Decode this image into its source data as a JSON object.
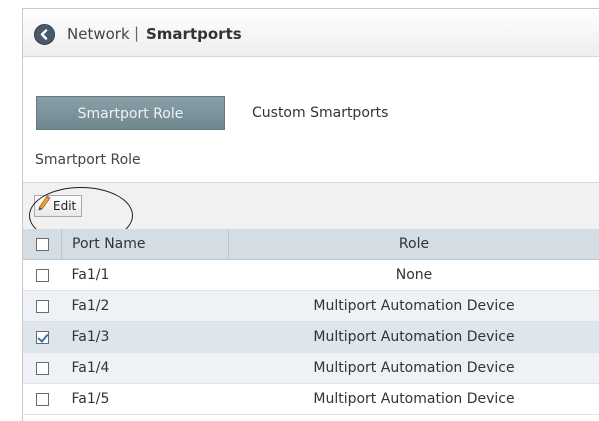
{
  "header": {
    "back_icon": "back-arrow-icon",
    "parent": "Network",
    "separator": "|",
    "current": "Smartports"
  },
  "tabs": [
    {
      "label": "Smartport Role",
      "active": true
    },
    {
      "label": "Custom Smartports",
      "active": false
    }
  ],
  "section": {
    "title": "Smartport Role"
  },
  "toolbar": {
    "edit_label": "Edit",
    "edit_icon": "pencil-icon"
  },
  "table": {
    "columns": [
      "",
      "Port Name",
      "Role"
    ],
    "rows": [
      {
        "port": "Fa1/1",
        "role": "None",
        "checked": false
      },
      {
        "port": "Fa1/2",
        "role": "Multiport Automation Device",
        "checked": false
      },
      {
        "port": "Fa1/3",
        "role": "Multiport Automation Device",
        "checked": true
      },
      {
        "port": "Fa1/4",
        "role": "Multiport Automation Device",
        "checked": false
      },
      {
        "port": "Fa1/5",
        "role": "Multiport Automation Device",
        "checked": false
      }
    ]
  },
  "colors": {
    "tab_active": "#7b929a",
    "header_row": "#d4dde4",
    "back_button": "#4a5a6b"
  }
}
